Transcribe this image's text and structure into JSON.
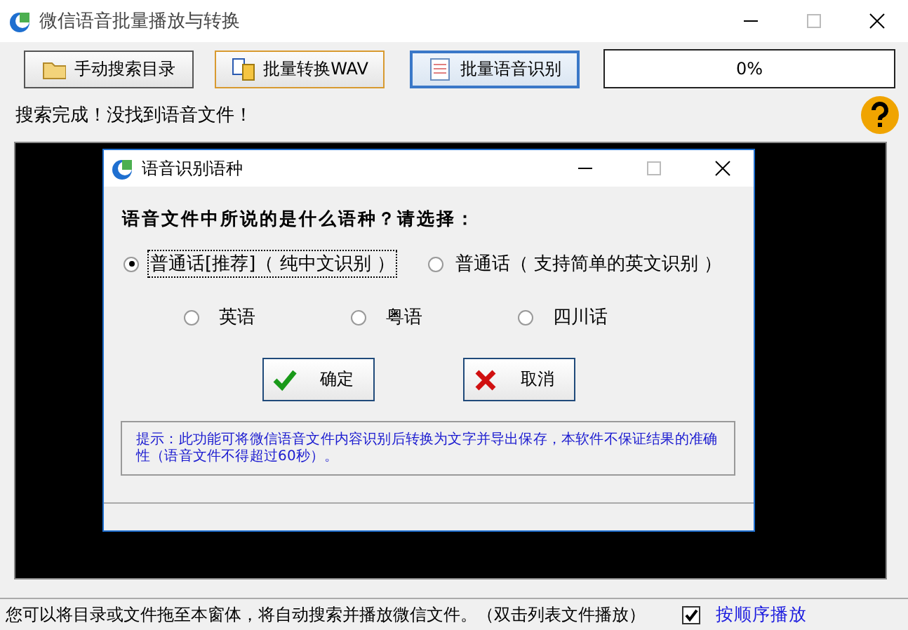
{
  "window": {
    "title": "微信语音批量播放与转换"
  },
  "toolbar": {
    "buttons": [
      {
        "label": "手动搜索目录",
        "kind": "folder",
        "selected": false
      },
      {
        "label": "批量转换WAV",
        "kind": "files",
        "selected": false
      },
      {
        "label": "批量语音识别",
        "kind": "notes",
        "selected": true
      }
    ],
    "progress": {
      "text": "0%",
      "level": 0
    }
  },
  "status": "搜索完成！没找到语音文件！",
  "dialog": {
    "title": "语音识别语种",
    "question": "语音文件中所说的是什么语种？请选择：",
    "options": [
      {
        "label": "普通话[推荐]（ 纯中文识别 ）",
        "selected": true
      },
      {
        "label": "普通话（ 支持简单的英文识别 ）",
        "selected": false
      },
      {
        "label": "英语",
        "selected": false
      },
      {
        "label": "粤语",
        "selected": false
      },
      {
        "label": "四川话",
        "selected": false
      }
    ],
    "buttons": [
      {
        "label": "确定",
        "kind": "ok"
      },
      {
        "label": "取消",
        "kind": "cancel"
      }
    ],
    "hint": "提示：此功能可将微信语音文件内容识别后转换为文字并导出保存，本软件不保证结果的准确性（语音文件不得超过60秒）。"
  },
  "footer": {
    "text": "您可以将目录或文件拖至本窗体，将自动搜索并播放微信文件。（双击列表文件播放）",
    "checkbox": {
      "label": "按顺序播放",
      "checked": true
    }
  }
}
